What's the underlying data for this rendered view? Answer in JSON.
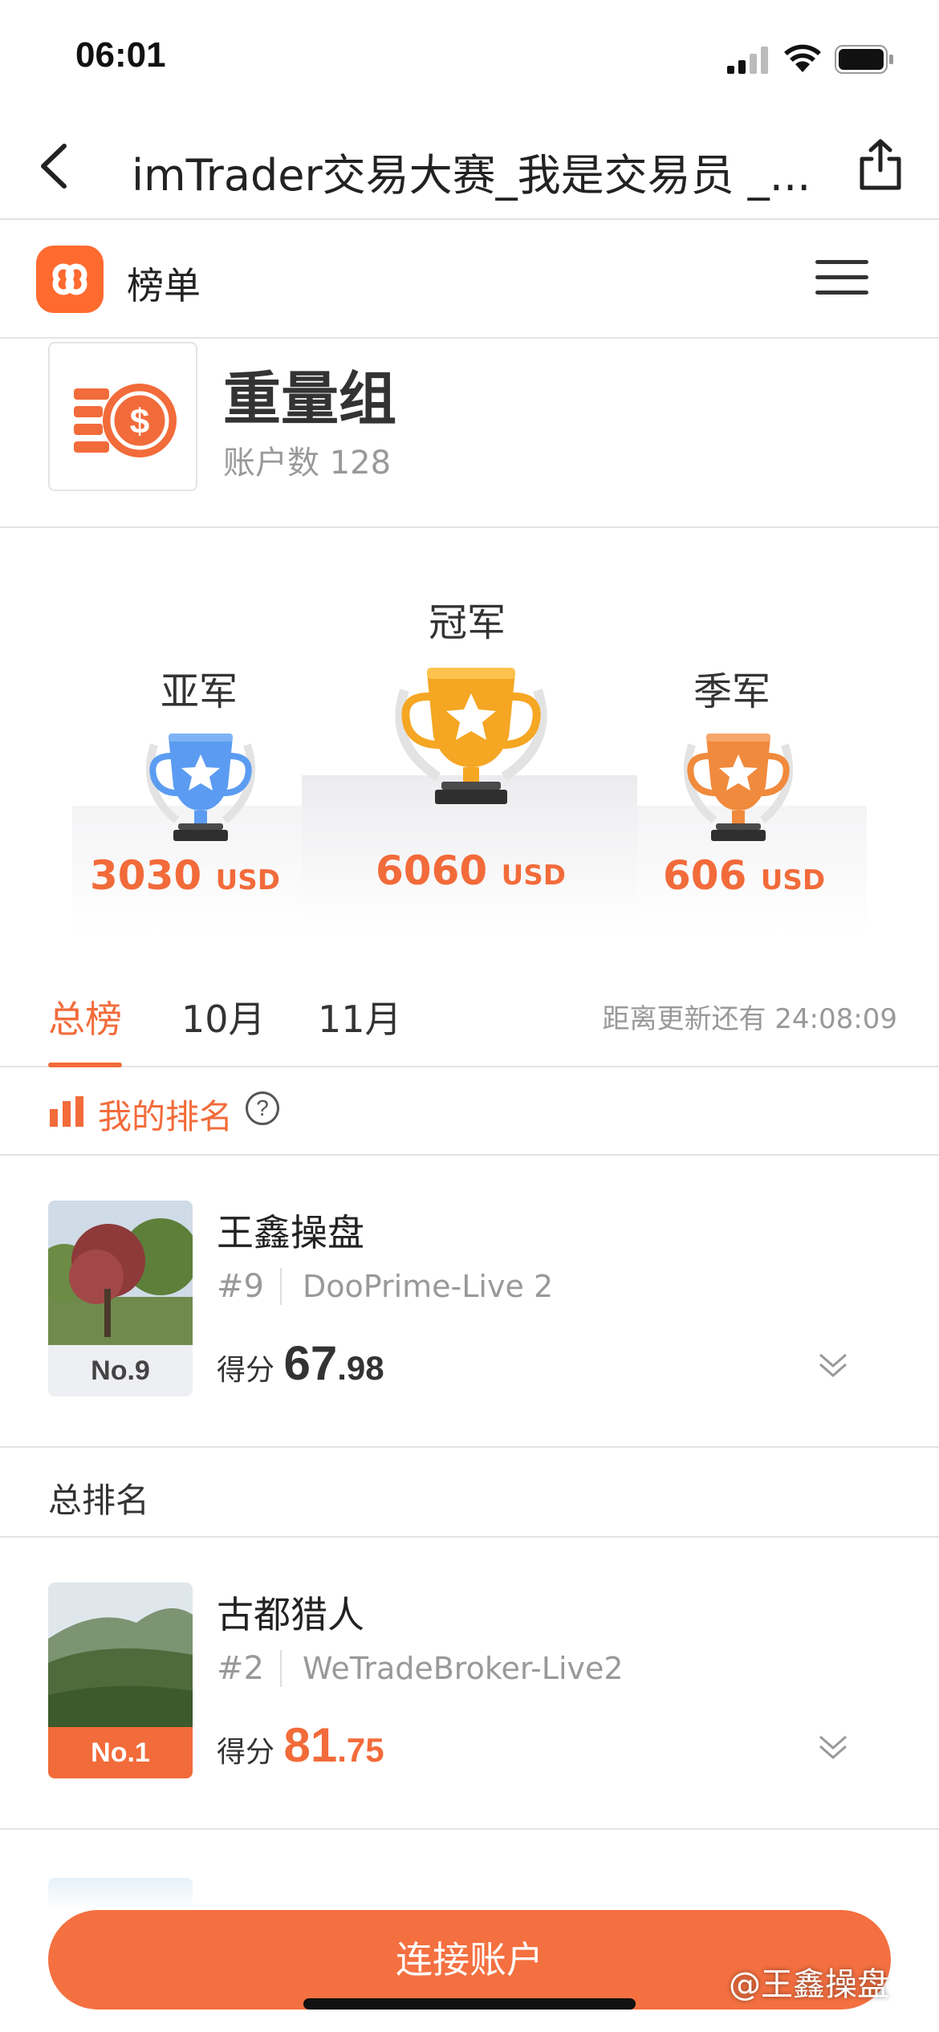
{
  "status": {
    "time": "06:01"
  },
  "nav": {
    "title": "imTrader交易大赛_我是交易员 _..."
  },
  "app": {
    "name": "榜单"
  },
  "group": {
    "title": "重量组",
    "count_label": "账户数 128"
  },
  "podium": {
    "second": {
      "label": "亚军",
      "amount": "3030",
      "unit": "USD"
    },
    "first": {
      "label": "冠军",
      "amount": "6060",
      "unit": "USD"
    },
    "third": {
      "label": "季军",
      "amount": "606",
      "unit": "USD"
    }
  },
  "tabs": {
    "items": [
      "总榜",
      "10月",
      "11月"
    ],
    "active": "总榜",
    "countdown": "距离更新还有 24:08:09"
  },
  "my_rank": {
    "label": "我的排名",
    "help": "?"
  },
  "my_card": {
    "name": "王鑫操盘",
    "rank_badge": "No.9",
    "number": "#9",
    "server": "DooPrime-Live 2",
    "score_label": "得分",
    "score_int": "67",
    "score_dec": ".98"
  },
  "overall": {
    "label": "总排名"
  },
  "top_card": {
    "name": "古都猎人",
    "rank_badge": "No.1",
    "number": "#2",
    "server": "WeTradeBroker-Live2",
    "score_label": "得分",
    "score_int": "81",
    "score_dec": ".75"
  },
  "cta": {
    "label": "连接账户"
  },
  "watermark": "@王鑫操盘",
  "colors": {
    "accent": "#f26b3a",
    "cta": "#f47040",
    "gold": "#f5a623",
    "silver_blue": "#5b9cf2",
    "bronze": "#f08a3c"
  }
}
